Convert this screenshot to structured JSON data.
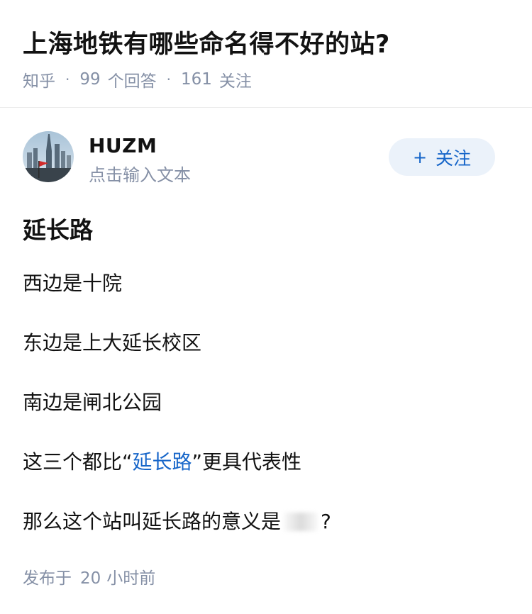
{
  "question": {
    "title": "上海地铁有哪些命名得不好的站?",
    "source": "知乎",
    "answer_count": "99",
    "answer_label": "个回答",
    "follower_count": "161",
    "follower_label": "关注",
    "separator": "·"
  },
  "author": {
    "name": "HUZM",
    "bio": "点击输入文本",
    "avatar_icon": "skyline-avatar-icon",
    "follow_plus": "+",
    "follow_label": "关注"
  },
  "answer": {
    "heading": "延长路",
    "paragraphs": {
      "p1": "西边是十院",
      "p2": "东边是上大延长校区",
      "p3": "南边是闸北公园",
      "p4_pre": "这三个都比“",
      "p4_link": "延长路",
      "p4_post": "”更具代表性",
      "p5_pre": "那么这个站叫延长路的意义是",
      "p5_post": "?"
    }
  },
  "footer": {
    "publish_prefix": "发布于",
    "publish_num": "20",
    "publish_suffix": "小时前"
  },
  "colors": {
    "text": "#121212",
    "meta": "#8590a6",
    "link": "#1766c9",
    "follow_bg": "#ebf2fa"
  }
}
